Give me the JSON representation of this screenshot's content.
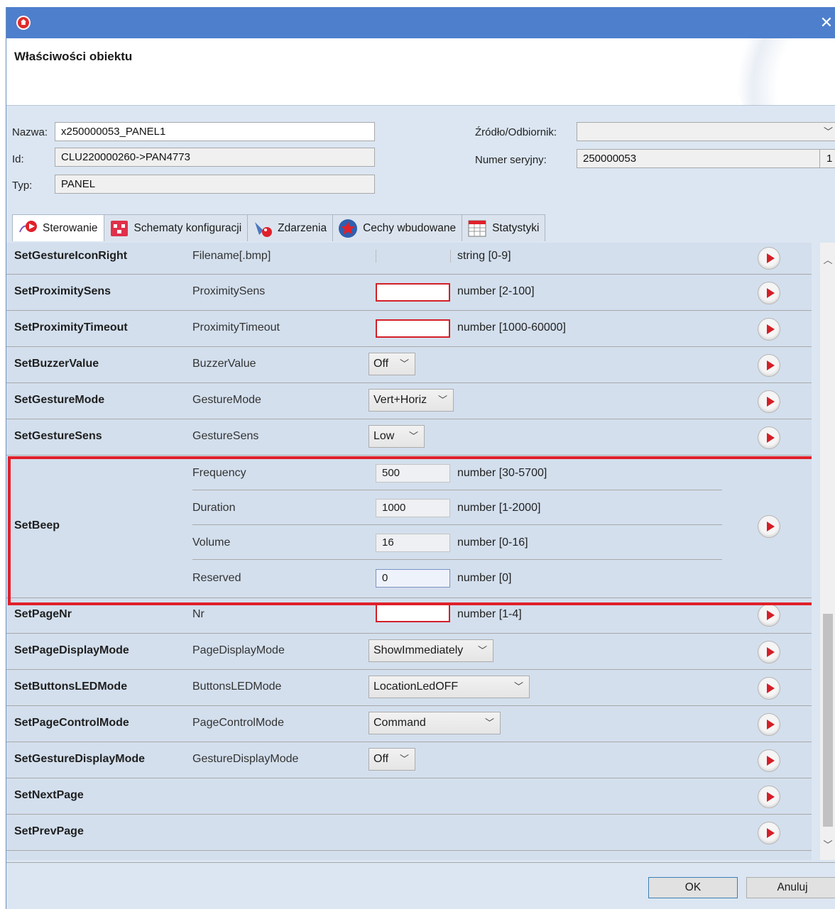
{
  "window": {
    "title": "Właściwości obiektu",
    "close_glyph": "✕"
  },
  "props": {
    "name_label": "Nazwa:",
    "name_value": "x250000053_PANEL1",
    "id_label": "Id:",
    "id_value": "CLU220000260->PAN4773",
    "type_label": "Typ:",
    "type_value": "PANEL",
    "source_label": "Źródło/Odbiornik:",
    "source_value": "",
    "serial_label": "Numer seryjny:",
    "serial_value": "250000053",
    "serial_extra": "1"
  },
  "tabs": [
    {
      "label": "Sterowanie",
      "icon": "control-hand-icon"
    },
    {
      "label": "Schematy konfiguracji",
      "icon": "schema-icon"
    },
    {
      "label": "Zdarzenia",
      "icon": "events-icon"
    },
    {
      "label": "Cechy wbudowane",
      "icon": "features-star-icon"
    },
    {
      "label": "Statystyki",
      "icon": "statistics-table-icon"
    }
  ],
  "rows": [
    {
      "name": "SetGestureIconRight",
      "param": "Filename[.bmp]",
      "desc": "string [0-9]"
    },
    {
      "name": "SetProximitySens",
      "param": "ProximitySens",
      "desc": "number [2-100]"
    },
    {
      "name": "SetProximityTimeout",
      "param": "ProximityTimeout",
      "desc": "number [1000-60000]"
    },
    {
      "name": "SetBuzzerValue",
      "param": "BuzzerValue",
      "select": "Off"
    },
    {
      "name": "SetGestureMode",
      "param": "GestureMode",
      "select": "Vert+Horiz"
    },
    {
      "name": "SetGestureSens",
      "param": "GestureSens",
      "select": "Low"
    },
    {
      "name": "SetBeep",
      "params": [
        {
          "param": "Frequency",
          "value": "500",
          "desc": "number [30-5700]"
        },
        {
          "param": "Duration",
          "value": "1000",
          "desc": "number [1-2000]"
        },
        {
          "param": "Volume",
          "value": "16",
          "desc": "number [0-16]"
        },
        {
          "param": "Reserved",
          "value": "0",
          "desc": "number [0]"
        }
      ]
    },
    {
      "name": "SetPageNr",
      "param": "Nr",
      "desc": "number [1-4]"
    },
    {
      "name": "SetPageDisplayMode",
      "param": "PageDisplayMode",
      "select": "ShowImmediately"
    },
    {
      "name": "SetButtonsLEDMode",
      "param": "ButtonsLEDMode",
      "select": "LocationLedOFF"
    },
    {
      "name": "SetPageControlMode",
      "param": "PageControlMode",
      "select": "Command"
    },
    {
      "name": "SetGestureDisplayMode",
      "param": "GestureDisplayMode",
      "select": "Off"
    },
    {
      "name": "SetNextPage"
    },
    {
      "name": "SetPrevPage"
    }
  ],
  "buttons": {
    "ok": "OK",
    "cancel": "Anuluj"
  },
  "colors": {
    "titlebar": "#4d7fcd",
    "grid_bg": "#d3dfed",
    "highlight": "#e0202a",
    "play_red": "#d41f27"
  }
}
